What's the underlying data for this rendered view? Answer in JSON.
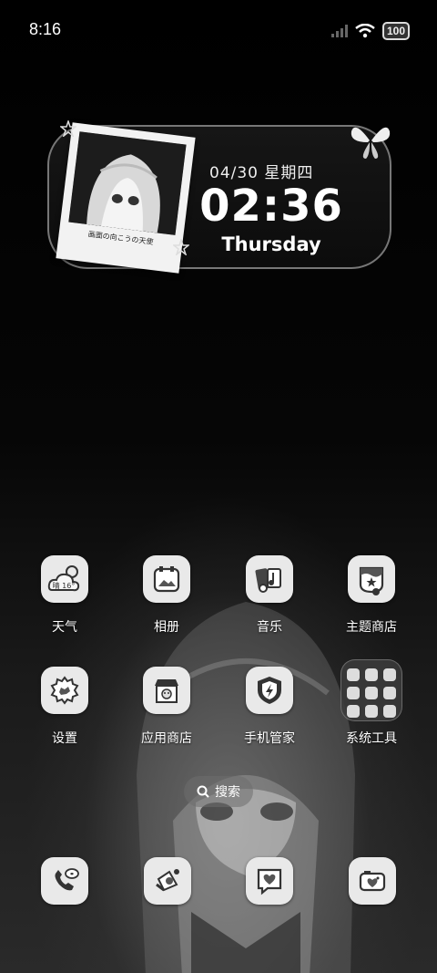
{
  "status_bar": {
    "time": "8:16",
    "battery": "100"
  },
  "widget": {
    "date": "04/30 星期四",
    "clock": "02:36",
    "weekday": "Thursday",
    "polaroid_caption": "画面の向こうの天使"
  },
  "apps": [
    {
      "label": "天气",
      "icon": "weather-icon",
      "badge": "晴 16°"
    },
    {
      "label": "相册",
      "icon": "gallery-icon"
    },
    {
      "label": "音乐",
      "icon": "music-icon"
    },
    {
      "label": "主题商店",
      "icon": "theme-store-icon"
    },
    {
      "label": "设置",
      "icon": "settings-icon"
    },
    {
      "label": "应用商店",
      "icon": "app-store-icon"
    },
    {
      "label": "手机管家",
      "icon": "security-icon"
    },
    {
      "label": "系统工具",
      "icon": "folder-icon"
    }
  ],
  "search": {
    "label": "搜索"
  },
  "dock": [
    {
      "icon": "phone-icon"
    },
    {
      "icon": "browser-icon"
    },
    {
      "icon": "messages-icon"
    },
    {
      "icon": "camera-icon"
    }
  ],
  "colors": {
    "icon_bg": "#e9e9e9",
    "icon_fg": "#333333",
    "background": "#000000"
  }
}
